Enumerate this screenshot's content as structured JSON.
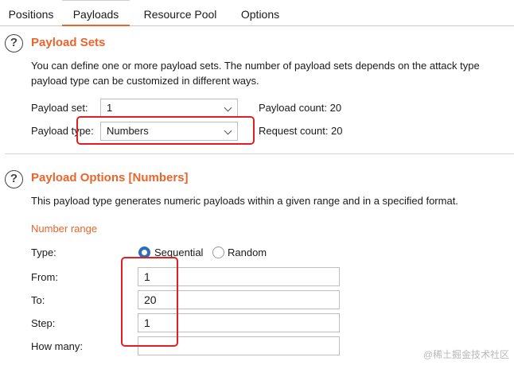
{
  "tabs": [
    {
      "label": "Positions",
      "active": false
    },
    {
      "label": "Payloads",
      "active": true
    },
    {
      "label": "Resource Pool",
      "active": false
    },
    {
      "label": "Options",
      "active": false
    }
  ],
  "payload_sets": {
    "help_icon": "?",
    "heading": "Payload Sets",
    "description_line1": "You can define one or more payload sets. The number of payload sets depends on the attack type",
    "description_line2": "payload type can be customized in different ways.",
    "payload_set_label": "Payload set:",
    "payload_set_value": "1",
    "payload_count": "Payload count: 20",
    "payload_type_label": "Payload type:",
    "payload_type_value": "Numbers",
    "request_count": "Request count: 20"
  },
  "payload_options": {
    "help_icon": "?",
    "heading": "Payload Options [Numbers]",
    "description": "This payload type generates numeric payloads within a given range and in a specified format.",
    "number_range_heading": "Number range",
    "type_label": "Type:",
    "type_options": [
      "Sequential",
      "Random"
    ],
    "type_selected": "Sequential",
    "from_label": "From:",
    "from_value": "1",
    "to_label": "To:",
    "to_value": "20",
    "step_label": "Step:",
    "step_value": "1",
    "how_many_label": "How many:",
    "how_many_value": ""
  },
  "watermark": "@稀土掘金技术社区",
  "colors": {
    "accent": "#e8652c",
    "highlight": "#e02020",
    "radio": "#2a6fb8"
  }
}
